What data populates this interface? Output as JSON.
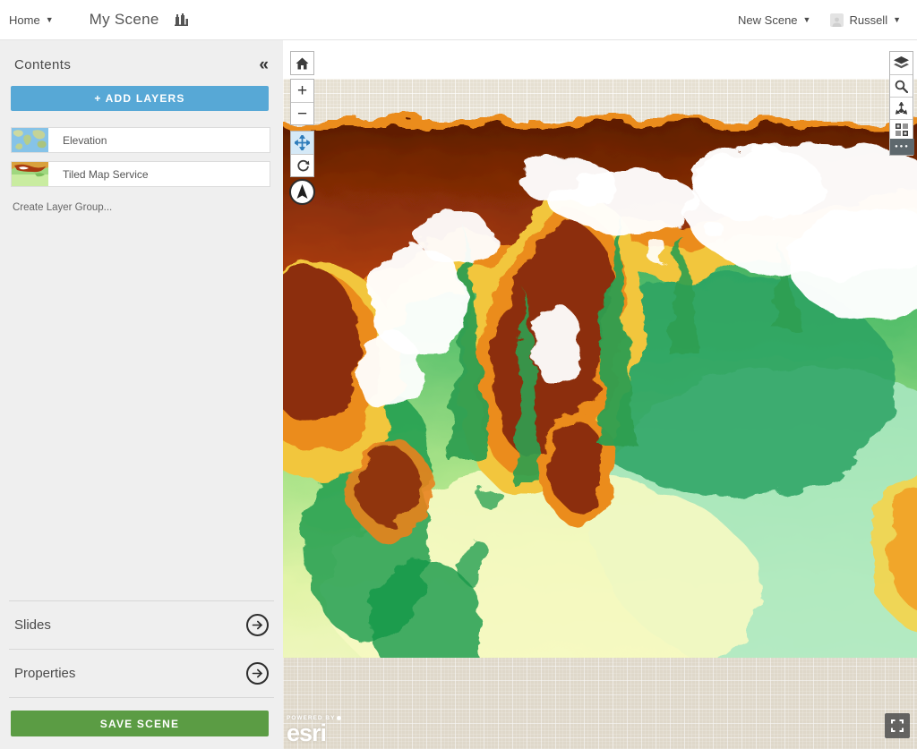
{
  "header": {
    "home_label": "Home",
    "title": "My Scene",
    "new_scene_label": "New Scene",
    "user_name": "Russell"
  },
  "sidebar": {
    "contents_title": "Contents",
    "collapse_glyph": "«",
    "add_layers_label": "+ ADD LAYERS",
    "layers": [
      {
        "label": "Elevation"
      },
      {
        "label": "Tiled Map Service"
      }
    ],
    "create_layer_group_label": "Create Layer Group...",
    "slides_label": "Slides",
    "properties_label": "Properties",
    "save_scene_label": "SAVE SCENE"
  },
  "map": {
    "zoom_in_glyph": "+",
    "zoom_out_glyph": "−",
    "more_glyph": "●●●",
    "esri": {
      "powered_by": "POWERED BY",
      "brand": "esri"
    }
  },
  "colors": {
    "accent_blue": "#57a8d6",
    "save_green": "#5b9c44",
    "pan_active_blue": "#2e7cba",
    "panel_gray": "#efefef",
    "grid_beige": "#e6e0d2"
  }
}
